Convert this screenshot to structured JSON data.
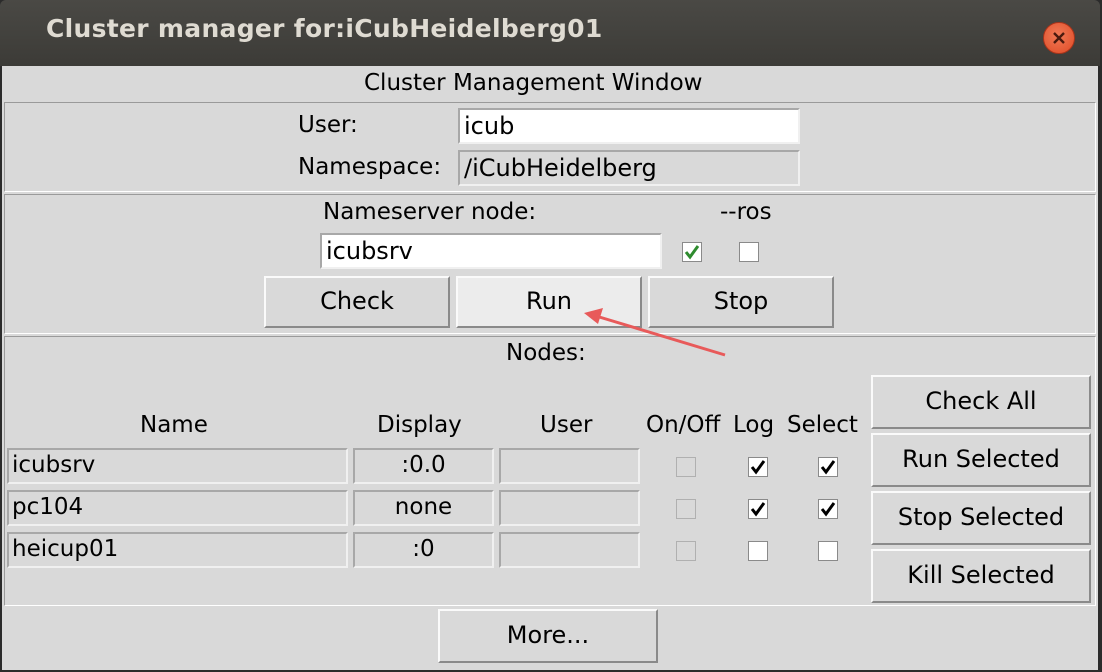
{
  "window": {
    "title": "Cluster manager for:iCubHeidelberg01"
  },
  "header": {
    "title": "Cluster Management Window"
  },
  "user": {
    "label": "User:",
    "value": "icub"
  },
  "namespace": {
    "label": "Namespace:",
    "value": "/iCubHeidelberg"
  },
  "nameserver": {
    "label": "Nameserver node:",
    "ros_label": "--ros",
    "value": "icubsrv",
    "enabled_checked": true,
    "ros_checked": false,
    "buttons": {
      "check": "Check",
      "run": "Run",
      "stop": "Stop"
    }
  },
  "nodes": {
    "title": "Nodes:",
    "columns": [
      "Name",
      "Display",
      "User",
      "On/Off",
      "Log",
      "Select"
    ],
    "rows": [
      {
        "name": "icubsrv",
        "display": ":0.0",
        "user": "",
        "on": false,
        "log": true,
        "select": true
      },
      {
        "name": "pc104",
        "display": "none",
        "user": "",
        "on": false,
        "log": true,
        "select": true
      },
      {
        "name": "heicup01",
        "display": ":0",
        "user": "",
        "on": false,
        "log": false,
        "select": false
      }
    ],
    "buttons": {
      "check_all": "Check All",
      "run_selected": "Run Selected",
      "stop_selected": "Stop Selected",
      "kill_selected": "Kill Selected"
    }
  },
  "footer": {
    "more": "More..."
  },
  "colors": {
    "check_green": "#2e8b2e",
    "arrow": "#e85a5a"
  }
}
